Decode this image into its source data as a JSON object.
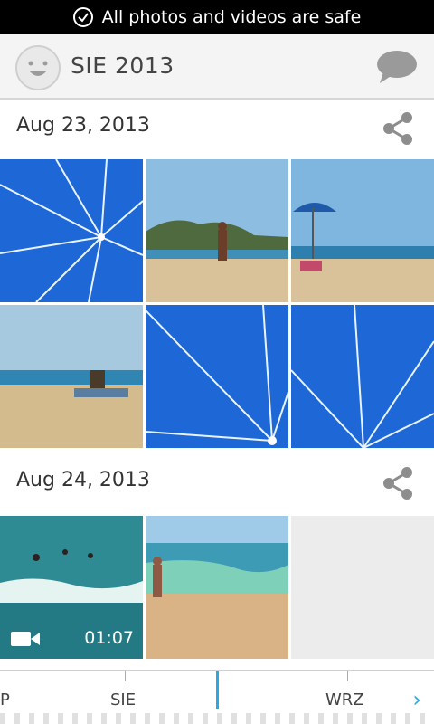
{
  "status_bar": {
    "message": "All photos and videos are safe"
  },
  "app_bar": {
    "title": "SIE 2013"
  },
  "sections": [
    {
      "date": "Aug 23, 2013"
    },
    {
      "date": "Aug 24, 2013"
    }
  ],
  "video": {
    "duration": "01:07"
  },
  "timeline": {
    "left_label": "P",
    "center_label": "SIE",
    "right_label": "WRZ",
    "next_symbol": "›"
  },
  "colors": {
    "accent": "#29a9e1",
    "umbrella_blue": "#1d68d6",
    "sky": "#7fb6df",
    "sand": "#d9c29a"
  },
  "icons": [
    "check-circle-icon",
    "avatar-face-icon",
    "chat-bubble-icon",
    "share-icon",
    "video-camera-icon",
    "chevron-right-icon"
  ]
}
